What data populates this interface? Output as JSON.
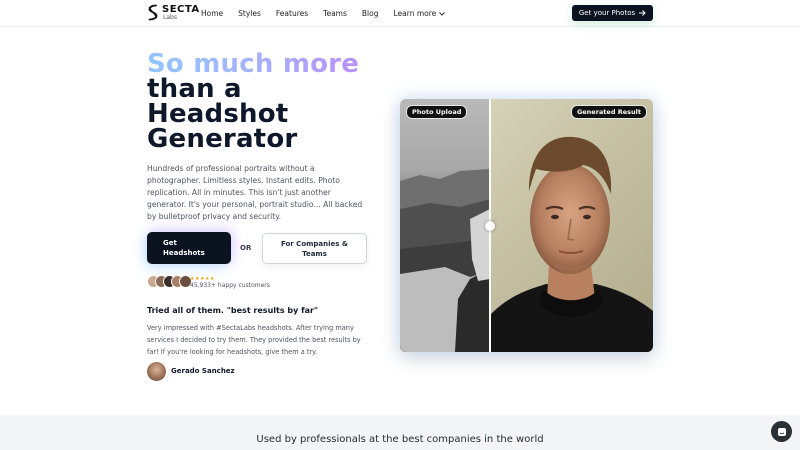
{
  "brand": {
    "name": "SECTA",
    "sub": "Labs"
  },
  "nav": {
    "items": [
      {
        "label": "Home"
      },
      {
        "label": "Styles"
      },
      {
        "label": "Features"
      },
      {
        "label": "Teams"
      },
      {
        "label": "Blog"
      }
    ],
    "more_label": "Learn more",
    "cta_label": "Get your Photos",
    "cta_icon": "arrow-right-icon"
  },
  "hero": {
    "title_highlight": "So much more",
    "title_rest_1": "than a",
    "title_rest_2": "Headshot",
    "title_rest_3": "Generator",
    "description": "Hundreds of professional portraits without a photographer. Limitless styles. Instant edits. Photo replication. All in minutes. This isn't just another generator. It's your personal, portrait studio... All backed by bulletproof privacy and security.",
    "primary_button_line1": "Get",
    "primary_button_line2": "Headshots",
    "or_label": "OR",
    "secondary_button_line1": "For Companies &",
    "secondary_button_line2": "Teams",
    "stars": "★★★★★",
    "customers_text": "45,933+ happy customers"
  },
  "testimonial": {
    "title": "Tried all of them. \"best results by far\"",
    "body": "Very impressed with #SectaLabs headshots. After trying many services I decided to try them. They provided the best results by far! If you're looking for headshots, give them a try.",
    "author": "Gerado Sanchez"
  },
  "comparison": {
    "left_tag": "Photo Upload",
    "right_tag": "Generated Result"
  },
  "band": {
    "text": "Used by professionals at the best companies in the world"
  },
  "colors": {
    "primary": "#0b1220",
    "gradient_start": "#93c5fd",
    "gradient_end": "#c084fc",
    "star": "#f59e0b"
  }
}
